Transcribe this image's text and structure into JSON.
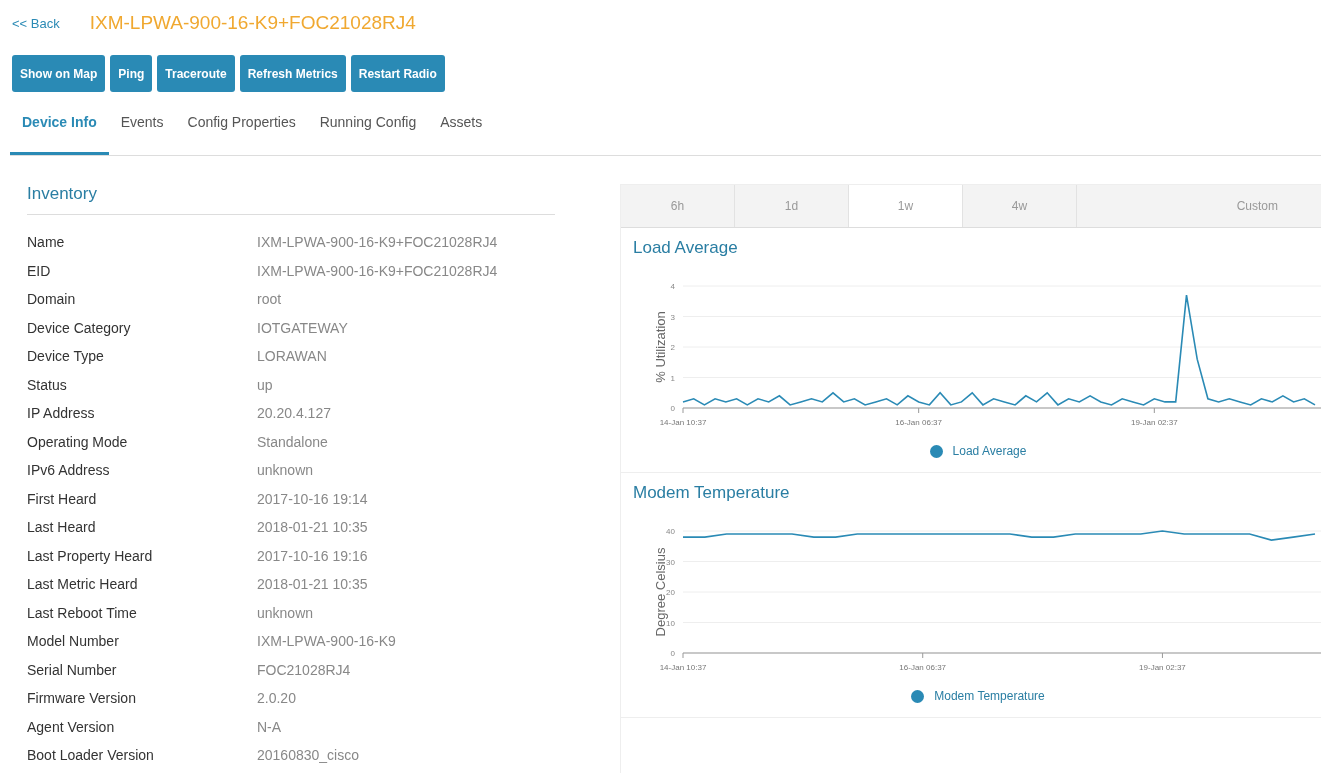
{
  "header": {
    "back_link": "<< Back",
    "title": "IXM-LPWA-900-16-K9+FOC21028RJ4"
  },
  "actions": [
    "Show on Map",
    "Ping",
    "Traceroute",
    "Refresh Metrics",
    "Restart Radio"
  ],
  "tabs": [
    {
      "label": "Device Info",
      "selected": true
    },
    {
      "label": "Events",
      "selected": false
    },
    {
      "label": "Config Properties",
      "selected": false
    },
    {
      "label": "Running Config",
      "selected": false
    },
    {
      "label": "Assets",
      "selected": false
    }
  ],
  "inventory": {
    "title": "Inventory",
    "rows": [
      {
        "label": "Name",
        "value": "IXM-LPWA-900-16-K9+FOC21028RJ4"
      },
      {
        "label": "EID",
        "value": "IXM-LPWA-900-16-K9+FOC21028RJ4"
      },
      {
        "label": "Domain",
        "value": "root"
      },
      {
        "label": "Device Category",
        "value": "IOTGATEWAY"
      },
      {
        "label": "Device Type",
        "value": "LORAWAN"
      },
      {
        "label": "Status",
        "value": "up"
      },
      {
        "label": "IP Address",
        "value": "20.20.4.127"
      },
      {
        "label": "Operating Mode",
        "value": "Standalone"
      },
      {
        "label": "IPv6 Address",
        "value": "unknown"
      },
      {
        "label": "First Heard",
        "value": "2017-10-16 19:14"
      },
      {
        "label": "Last Heard",
        "value": "2018-01-21 10:35"
      },
      {
        "label": "Last Property Heard",
        "value": "2017-10-16 19:16"
      },
      {
        "label": "Last Metric Heard",
        "value": "2018-01-21 10:35"
      },
      {
        "label": "Last Reboot Time",
        "value": "unknown"
      },
      {
        "label": "Model Number",
        "value": "IXM-LPWA-900-16-K9"
      },
      {
        "label": "Serial Number",
        "value": "FOC21028RJ4"
      },
      {
        "label": "Firmware Version",
        "value": "2.0.20"
      },
      {
        "label": "Agent Version",
        "value": "N-A"
      },
      {
        "label": "Boot Loader Version",
        "value": "20160830_cisco"
      }
    ]
  },
  "time_ranges": [
    {
      "label": "6h",
      "selected": false
    },
    {
      "label": "1d",
      "selected": false
    },
    {
      "label": "1w",
      "selected": true
    },
    {
      "label": "4w",
      "selected": false
    },
    {
      "label": "Custom",
      "selected": false
    }
  ],
  "charts": [
    {
      "title": "Load Average",
      "chart_data": {
        "type": "line",
        "ylabel": "% Utilization",
        "categories": [
          "14-Jan 10:37",
          null,
          null,
          null,
          null,
          null,
          null,
          null,
          null,
          null,
          null,
          null,
          null,
          null,
          null,
          null,
          null,
          null,
          null,
          null,
          null,
          null,
          "16-Jan 06:37",
          null,
          null,
          null,
          null,
          null,
          null,
          null,
          null,
          null,
          null,
          null,
          null,
          null,
          null,
          null,
          null,
          null,
          null,
          null,
          null,
          null,
          "19-Jan 02:37",
          null,
          null,
          null,
          null,
          null,
          null,
          null,
          null,
          null,
          null,
          null,
          null,
          null,
          null,
          null
        ],
        "series": [
          {
            "name": "Load Average",
            "color": "#2a8ab5",
            "values": [
              0.2,
              0.3,
              0.1,
              0.3,
              0.2,
              0.3,
              0.1,
              0.3,
              0.2,
              0.4,
              0.1,
              0.2,
              0.3,
              0.2,
              0.5,
              0.2,
              0.3,
              0.1,
              0.2,
              0.3,
              0.1,
              0.4,
              0.2,
              0.1,
              0.5,
              0.1,
              0.2,
              0.5,
              0.1,
              0.3,
              0.2,
              0.1,
              0.4,
              0.2,
              0.5,
              0.1,
              0.3,
              0.2,
              0.4,
              0.2,
              0.1,
              0.3,
              0.2,
              0.1,
              0.3,
              0.2,
              0.2,
              3.7,
              1.6,
              0.3,
              0.2,
              0.3,
              0.2,
              0.1,
              0.3,
              0.2,
              0.4,
              0.2,
              0.3,
              0.1
            ]
          }
        ],
        "ylim": [
          0,
          4
        ],
        "yticks": [
          0,
          1,
          2,
          3,
          4
        ],
        "grid": true
      }
    },
    {
      "title": "Modem Temperature",
      "chart_data": {
        "type": "line",
        "ylabel": "Degree Celsius",
        "categories": [
          "14-Jan 10:37",
          null,
          null,
          null,
          null,
          null,
          null,
          null,
          null,
          null,
          null,
          "16-Jan 06:37",
          null,
          null,
          null,
          null,
          null,
          null,
          null,
          null,
          null,
          null,
          "19-Jan 02:37",
          null,
          null,
          null,
          null,
          null,
          null,
          null
        ],
        "series": [
          {
            "name": "Modem Temperature",
            "color": "#2a8ab5",
            "values": [
              38,
              38,
              39,
              39,
              39,
              39,
              38,
              38,
              39,
              39,
              39,
              39,
              39,
              39,
              39,
              39,
              38,
              38,
              39,
              39,
              39,
              39,
              40,
              39,
              39,
              39,
              39,
              37,
              38,
              39
            ]
          }
        ],
        "ylim": [
          0,
          40
        ],
        "yticks": [
          0,
          10,
          20,
          30,
          40
        ],
        "grid": true
      }
    }
  ]
}
